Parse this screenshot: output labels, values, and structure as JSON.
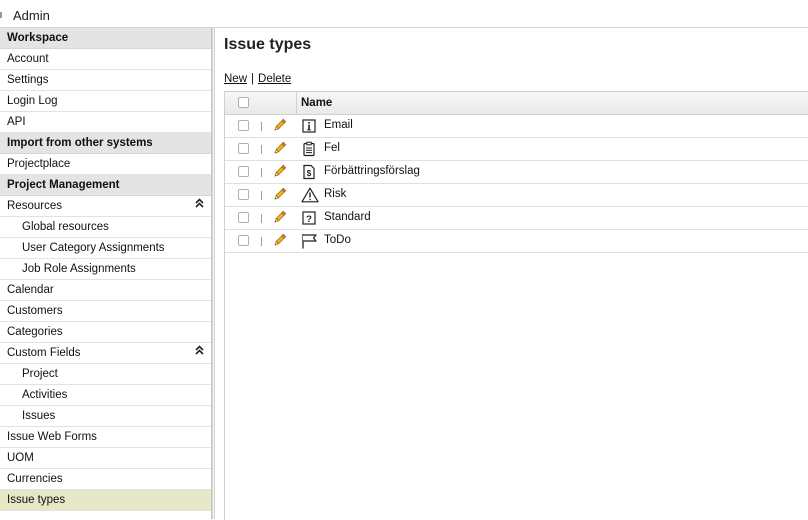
{
  "app": {
    "title": "Admin"
  },
  "sidebar": {
    "items": [
      {
        "label": "Workspace",
        "kind": "section"
      },
      {
        "label": "Account",
        "kind": "item"
      },
      {
        "label": "Settings",
        "kind": "item"
      },
      {
        "label": "Login Log",
        "kind": "item"
      },
      {
        "label": "API",
        "kind": "item"
      },
      {
        "label": "Import from other systems",
        "kind": "section"
      },
      {
        "label": "Projectplace",
        "kind": "item"
      },
      {
        "label": "Project Management",
        "kind": "section"
      },
      {
        "label": "Resources",
        "kind": "item",
        "collapse": "collapse-up-icon"
      },
      {
        "label": "Global resources",
        "kind": "sub"
      },
      {
        "label": "User Category Assignments",
        "kind": "sub"
      },
      {
        "label": "Job Role Assignments",
        "kind": "sub"
      },
      {
        "label": "Calendar",
        "kind": "item"
      },
      {
        "label": "Customers",
        "kind": "item"
      },
      {
        "label": "Categories",
        "kind": "item"
      },
      {
        "label": "Custom Fields",
        "kind": "item",
        "collapse": "collapse-up-icon"
      },
      {
        "label": "Project",
        "kind": "sub"
      },
      {
        "label": "Activities",
        "kind": "sub"
      },
      {
        "label": "Issues",
        "kind": "sub"
      },
      {
        "label": "Issue Web Forms",
        "kind": "item"
      },
      {
        "label": "UOM",
        "kind": "item"
      },
      {
        "label": "Currencies",
        "kind": "item"
      },
      {
        "label": "Issue types",
        "kind": "item",
        "selected": true
      }
    ]
  },
  "main": {
    "title": "Issue types",
    "actions": {
      "new": "New",
      "separator": "|",
      "delete": "Delete"
    },
    "table": {
      "header_name": "Name",
      "rows": [
        {
          "name": "Email",
          "icon": "info-icon"
        },
        {
          "name": "Fel",
          "icon": "clipboard-icon"
        },
        {
          "name": "Förbättringsförslag",
          "icon": "dollar-document-icon"
        },
        {
          "name": "Risk",
          "icon": "warning-icon"
        },
        {
          "name": "Standard",
          "icon": "question-icon"
        },
        {
          "name": "ToDo",
          "icon": "flag-icon"
        }
      ]
    }
  },
  "colors": {
    "selected_bg": "#e5e7c5",
    "section_bg": "#e4e4e4",
    "pencil": "#e8a317"
  }
}
